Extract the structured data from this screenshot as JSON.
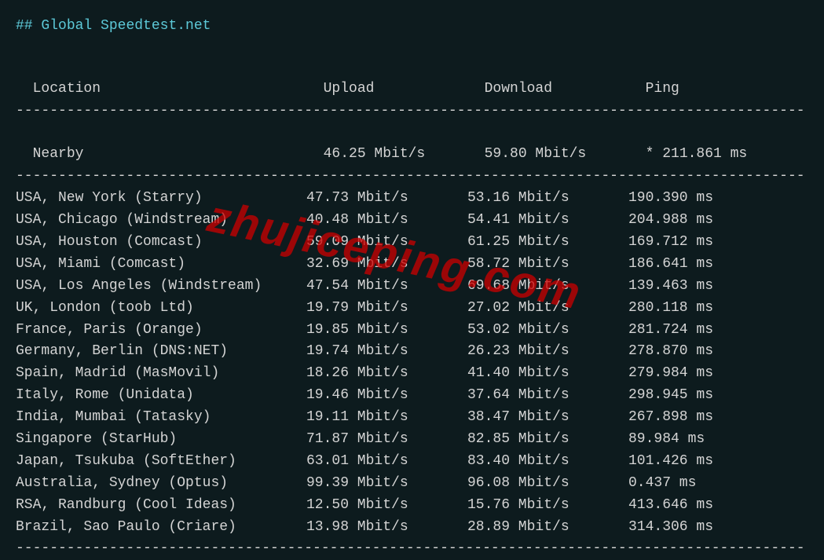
{
  "title_prefix": "##",
  "title_text": "Global Speedtest.net",
  "headers": {
    "location": "Location",
    "upload": "Upload",
    "download": "Download",
    "ping": "Ping"
  },
  "nearby": {
    "location": "Nearby",
    "upload": "46.25 Mbit/s",
    "download": "59.80 Mbit/s",
    "ping": "* 211.861 ms"
  },
  "rows": [
    {
      "location": "USA, New York (Starry)",
      "upload": "47.73 Mbit/s",
      "download": "53.16 Mbit/s",
      "ping": "190.390 ms"
    },
    {
      "location": "USA, Chicago (Windstream)",
      "upload": "40.48 Mbit/s",
      "download": "54.41 Mbit/s",
      "ping": "204.988 ms"
    },
    {
      "location": "USA, Houston (Comcast)",
      "upload": "59.09 Mbit/s",
      "download": "61.25 Mbit/s",
      "ping": "169.712 ms"
    },
    {
      "location": "USA, Miami (Comcast)",
      "upload": "32.69 Mbit/s",
      "download": "58.72 Mbit/s",
      "ping": "186.641 ms"
    },
    {
      "location": "USA, Los Angeles (Windstream)",
      "upload": "47.54 Mbit/s",
      "download": "69.68 Mbit/s",
      "ping": "139.463 ms"
    },
    {
      "location": "UK, London (toob Ltd)",
      "upload": "19.79 Mbit/s",
      "download": "27.02 Mbit/s",
      "ping": "280.118 ms"
    },
    {
      "location": "France, Paris (Orange)",
      "upload": "19.85 Mbit/s",
      "download": "53.02 Mbit/s",
      "ping": "281.724 ms"
    },
    {
      "location": "Germany, Berlin (DNS:NET)",
      "upload": "19.74 Mbit/s",
      "download": "26.23 Mbit/s",
      "ping": "278.870 ms"
    },
    {
      "location": "Spain, Madrid (MasMovil)",
      "upload": "18.26 Mbit/s",
      "download": "41.40 Mbit/s",
      "ping": "279.984 ms"
    },
    {
      "location": "Italy, Rome (Unidata)",
      "upload": "19.46 Mbit/s",
      "download": "37.64 Mbit/s",
      "ping": "298.945 ms"
    },
    {
      "location": "India, Mumbai (Tatasky)",
      "upload": "19.11 Mbit/s",
      "download": "38.47 Mbit/s",
      "ping": "267.898 ms"
    },
    {
      "location": "Singapore (StarHub)",
      "upload": "71.87 Mbit/s",
      "download": "82.85 Mbit/s",
      "ping": "89.984 ms"
    },
    {
      "location": "Japan, Tsukuba (SoftEther)",
      "upload": "63.01 Mbit/s",
      "download": "83.40 Mbit/s",
      "ping": "101.426 ms"
    },
    {
      "location": "Australia, Sydney (Optus)",
      "upload": "99.39 Mbit/s",
      "download": "96.08 Mbit/s",
      "ping": "0.437 ms"
    },
    {
      "location": "RSA, Randburg (Cool Ideas)",
      "upload": "12.50 Mbit/s",
      "download": "15.76 Mbit/s",
      "ping": "413.646 ms"
    },
    {
      "location": "Brazil, Sao Paulo (Criare)",
      "upload": "13.98 Mbit/s",
      "download": "28.89 Mbit/s",
      "ping": "314.306 ms"
    }
  ],
  "separator_line": "---------------------------------------------------------------------------------------------",
  "watermark_text": "zhujiceping.com",
  "chart_data": {
    "type": "table",
    "title": "Global Speedtest.net",
    "columns": [
      "Location",
      "Upload",
      "Download",
      "Ping"
    ],
    "data": [
      {
        "location": "Nearby",
        "upload_mbits": 46.25,
        "download_mbits": 59.8,
        "ping_ms": 211.861,
        "ping_note": "*"
      },
      {
        "location": "USA, New York (Starry)",
        "upload_mbits": 47.73,
        "download_mbits": 53.16,
        "ping_ms": 190.39
      },
      {
        "location": "USA, Chicago (Windstream)",
        "upload_mbits": 40.48,
        "download_mbits": 54.41,
        "ping_ms": 204.988
      },
      {
        "location": "USA, Houston (Comcast)",
        "upload_mbits": 59.09,
        "download_mbits": 61.25,
        "ping_ms": 169.712
      },
      {
        "location": "USA, Miami (Comcast)",
        "upload_mbits": 32.69,
        "download_mbits": 58.72,
        "ping_ms": 186.641
      },
      {
        "location": "USA, Los Angeles (Windstream)",
        "upload_mbits": 47.54,
        "download_mbits": 69.68,
        "ping_ms": 139.463
      },
      {
        "location": "UK, London (toob Ltd)",
        "upload_mbits": 19.79,
        "download_mbits": 27.02,
        "ping_ms": 280.118
      },
      {
        "location": "France, Paris (Orange)",
        "upload_mbits": 19.85,
        "download_mbits": 53.02,
        "ping_ms": 281.724
      },
      {
        "location": "Germany, Berlin (DNS:NET)",
        "upload_mbits": 19.74,
        "download_mbits": 26.23,
        "ping_ms": 278.87
      },
      {
        "location": "Spain, Madrid (MasMovil)",
        "upload_mbits": 18.26,
        "download_mbits": 41.4,
        "ping_ms": 279.984
      },
      {
        "location": "Italy, Rome (Unidata)",
        "upload_mbits": 19.46,
        "download_mbits": 37.64,
        "ping_ms": 298.945
      },
      {
        "location": "India, Mumbai (Tatasky)",
        "upload_mbits": 19.11,
        "download_mbits": 38.47,
        "ping_ms": 267.898
      },
      {
        "location": "Singapore (StarHub)",
        "upload_mbits": 71.87,
        "download_mbits": 82.85,
        "ping_ms": 89.984
      },
      {
        "location": "Japan, Tsukuba (SoftEther)",
        "upload_mbits": 63.01,
        "download_mbits": 83.4,
        "ping_ms": 101.426
      },
      {
        "location": "Australia, Sydney (Optus)",
        "upload_mbits": 99.39,
        "download_mbits": 96.08,
        "ping_ms": 0.437
      },
      {
        "location": "RSA, Randburg (Cool Ideas)",
        "upload_mbits": 12.5,
        "download_mbits": 15.76,
        "ping_ms": 413.646
      },
      {
        "location": "Brazil, Sao Paulo (Criare)",
        "upload_mbits": 13.98,
        "download_mbits": 28.89,
        "ping_ms": 314.306
      }
    ]
  }
}
